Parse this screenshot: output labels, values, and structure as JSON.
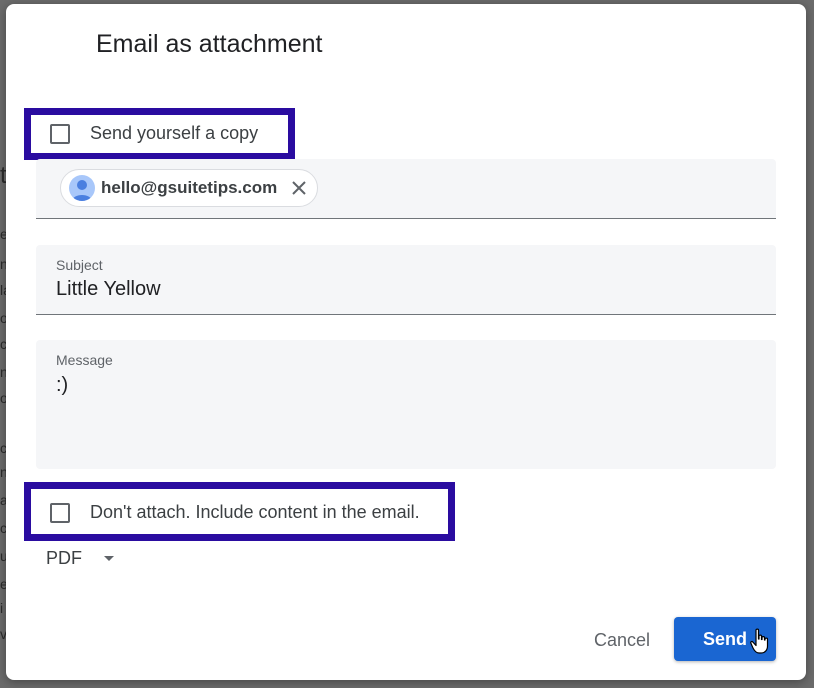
{
  "dialog": {
    "title": "Email as attachment"
  },
  "send_copy": {
    "label": "Send yourself a copy",
    "checked": false
  },
  "recipients": {
    "chips": [
      {
        "email": "hello@gsuitetips.com"
      }
    ]
  },
  "subject": {
    "label": "Subject",
    "value": "Little Yellow"
  },
  "message": {
    "label": "Message",
    "value": ":)"
  },
  "no_attach": {
    "label": "Don't attach. Include content in the email.",
    "checked": false
  },
  "format": {
    "selected": "PDF"
  },
  "actions": {
    "cancel_label": "Cancel",
    "send_label": "Send"
  },
  "colors": {
    "highlight_border": "#2a0ca0",
    "send_button": "#1a66d2",
    "field_background": "#f5f6f8"
  },
  "icons": {
    "chip_avatar": "person-avatar-icon",
    "chip_remove": "close-icon",
    "format_dropdown": "caret-down-icon",
    "pointer": "hand-cursor-icon"
  }
}
